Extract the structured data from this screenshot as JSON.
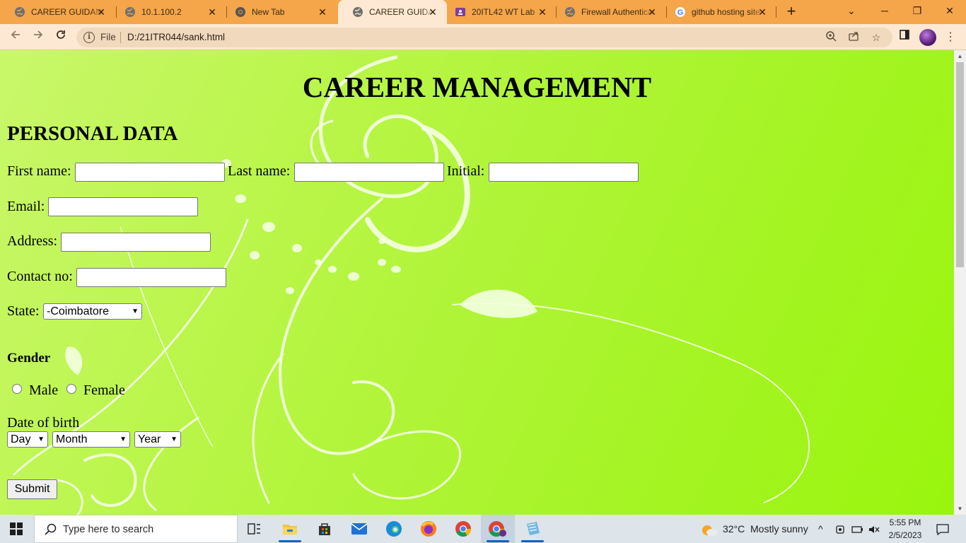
{
  "browser": {
    "tabs": [
      {
        "title": "CAREER GUIDANCE",
        "favicon": "globe-icon",
        "active": false
      },
      {
        "title": "10.1.100.2",
        "favicon": "globe-icon",
        "active": false
      },
      {
        "title": "New Tab",
        "favicon": "chrome-icon",
        "active": false
      },
      {
        "title": "CAREER GUIDANCE",
        "favicon": "globe-icon",
        "active": true
      },
      {
        "title": "20ITL42 WT Lab",
        "favicon": "classroom-icon",
        "active": false
      },
      {
        "title": "Firewall Authentication",
        "favicon": "globe-icon",
        "active": false
      },
      {
        "title": "github hosting site",
        "favicon": "google-icon",
        "active": false
      }
    ],
    "address": {
      "scheme_label": "File",
      "url": "D:/21ITR044/sank.html"
    }
  },
  "page": {
    "title": "CAREER MANAGEMENT",
    "section": "PERSONAL DATA",
    "first_name_label": "First name:",
    "last_name_label": "Last name:",
    "initial_label": "Initial:",
    "email_label": "Email:",
    "address_label": "Address:",
    "contact_label": "Contact no:",
    "state_label": "State:",
    "state_value": "-Coimbatore",
    "gender_label": "Gender",
    "male_label": "Male",
    "female_label": "Female",
    "dob_label": "Date of birth",
    "day_value": "Day",
    "month_value": "Month",
    "year_value": "Year",
    "submit_label": "Submit"
  },
  "taskbar": {
    "search_placeholder": "Type here to search",
    "weather_temp": "32°C",
    "weather_text": "Mostly sunny",
    "time": "5:55 PM",
    "date": "2/5/2023"
  },
  "colors": {
    "tab_strip": "#f5a54a",
    "toolbar": "#fde9d3",
    "page_background": "#b7f544"
  }
}
